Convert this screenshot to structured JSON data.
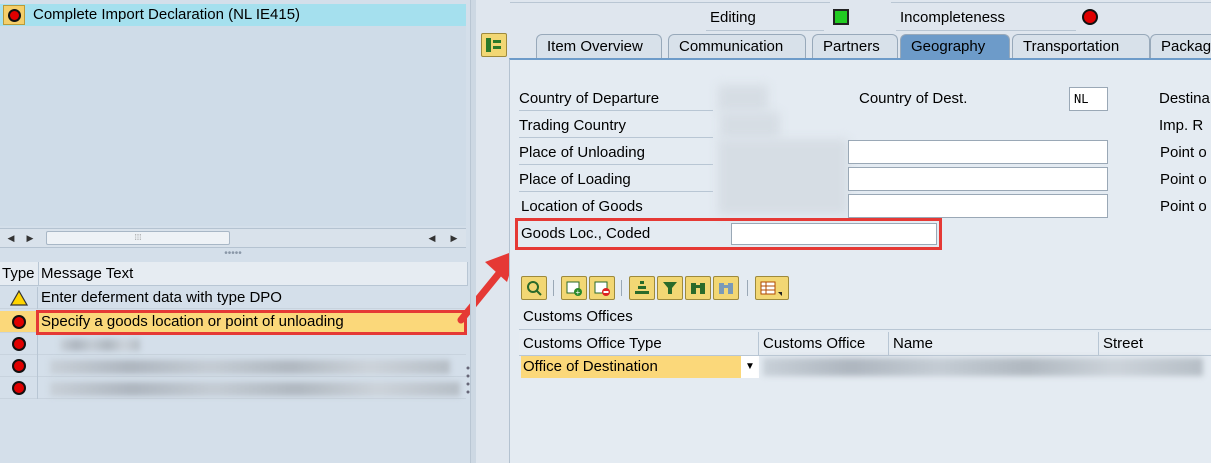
{
  "tree": {
    "selected_item": "Complete Import Declaration (NL IE415)",
    "item_icon": "error-status-icon"
  },
  "messages": {
    "headers": [
      "Type",
      "Message Text"
    ],
    "rows": [
      {
        "type": "warning",
        "text": "Enter deferment data with type DPO"
      },
      {
        "type": "error",
        "text": "Specify a goods location or point of unloading"
      },
      {
        "type": "error",
        "text": ""
      },
      {
        "type": "error",
        "text": ""
      },
      {
        "type": "error",
        "text": ""
      }
    ]
  },
  "status": {
    "editing_label": "Editing",
    "editing_status_color": "#22cc22",
    "incompleteness_label": "Incompleteness",
    "incompleteness_status_color": "#e00000"
  },
  "tabs": [
    "Item Overview",
    "Communication",
    "Partners",
    "Geography",
    "Transportation",
    "Packag"
  ],
  "active_tab": "Geography",
  "geography": {
    "left_fields": [
      "Country of Departure",
      "Trading Country",
      "Place of Unloading",
      "Place of Loading",
      "Location of Goods",
      "Goods Loc., Coded"
    ],
    "country_of_dest_label": "Country of Dest.",
    "country_of_dest_value": "NL",
    "right_fields": [
      "Destina",
      "Imp. R",
      "Point o",
      "Point o",
      "Point o"
    ],
    "goods_loc_coded_value": ""
  },
  "customs_offices": {
    "title": "Customs Offices",
    "headers": [
      "Customs Office Type",
      "Customs Office",
      "Name",
      "Street"
    ],
    "rows": [
      {
        "type": "Office of Destination",
        "office": "",
        "name": "",
        "street": ""
      }
    ]
  },
  "colors": {
    "highlight": "#e53935",
    "selected_row": "#fbd87a",
    "active_tab": "#6d9bc9"
  }
}
